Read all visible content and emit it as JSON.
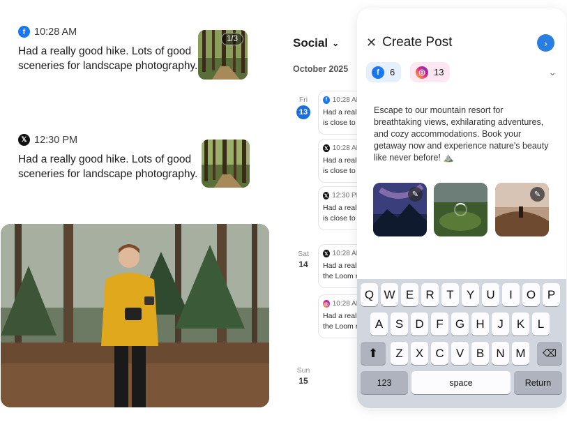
{
  "feed": {
    "posts": [
      {
        "network": "facebook",
        "time": "10:28 AM",
        "text": "Had a really good hike. Lots of good sceneries for landscape photography.",
        "image_counter": "1/3"
      },
      {
        "network": "x",
        "time": "12:30 PM",
        "text": "Had a really good hike. Lots of good sceneries for landscape photography."
      }
    ]
  },
  "calendar": {
    "title": "Social",
    "month": "October 2025",
    "days": [
      {
        "dow": "Fri",
        "num": "13"
      },
      {
        "dow": "Sat",
        "num": "14"
      },
      {
        "dow": "Sun",
        "num": "15"
      }
    ],
    "events": [
      {
        "network": "facebook",
        "time": "10:28 AM",
        "line1": "Had a real",
        "line2": "is close to t"
      },
      {
        "network": "x",
        "time": "10:28 AM",
        "line1": "Had a real",
        "line2": "is close to t"
      },
      {
        "network": "x",
        "time": "12:30 PM",
        "line1": "Had a real",
        "line2": "is close to t"
      },
      {
        "network": "x",
        "time": "10:28 AM",
        "line1": "Had a real",
        "line2": "the Loom r"
      },
      {
        "network": "instagram",
        "time": "10:28 AM",
        "line1": "Had a real",
        "line2": "the Loom r"
      }
    ]
  },
  "create_post": {
    "title": "Create Post",
    "accounts": [
      {
        "network": "facebook",
        "count": "6"
      },
      {
        "network": "instagram",
        "count": "13"
      }
    ],
    "caption": "Escape to our mountain resort for breathtaking views, exhilarating adventures, and cozy accommodations. Book your getaway now and experience nature's beauty like never before! ⛰️",
    "attachments": [
      "milky-way-mountains",
      "green-hills-loading",
      "desert-sunset-person"
    ]
  },
  "keyboard": {
    "row1": [
      "Q",
      "W",
      "E",
      "R",
      "T",
      "Y",
      "U",
      "I",
      "O",
      "P"
    ],
    "row2": [
      "A",
      "S",
      "D",
      "F",
      "G",
      "H",
      "J",
      "K",
      "L"
    ],
    "row3": [
      "Z",
      "X",
      "C",
      "V",
      "B",
      "N",
      "M"
    ],
    "numbers_label": "123",
    "space_label": "space",
    "return_label": "Return"
  },
  "colors": {
    "accent": "#2a7de1",
    "facebook": "#1877f2",
    "keyboard_bg": "#d2d6de"
  },
  "icons": {
    "close": "close-icon",
    "next": "chevron-right-icon",
    "expand": "chevron-down-icon",
    "edit": "pencil-icon",
    "shift": "shift-icon",
    "backspace": "backspace-icon"
  }
}
